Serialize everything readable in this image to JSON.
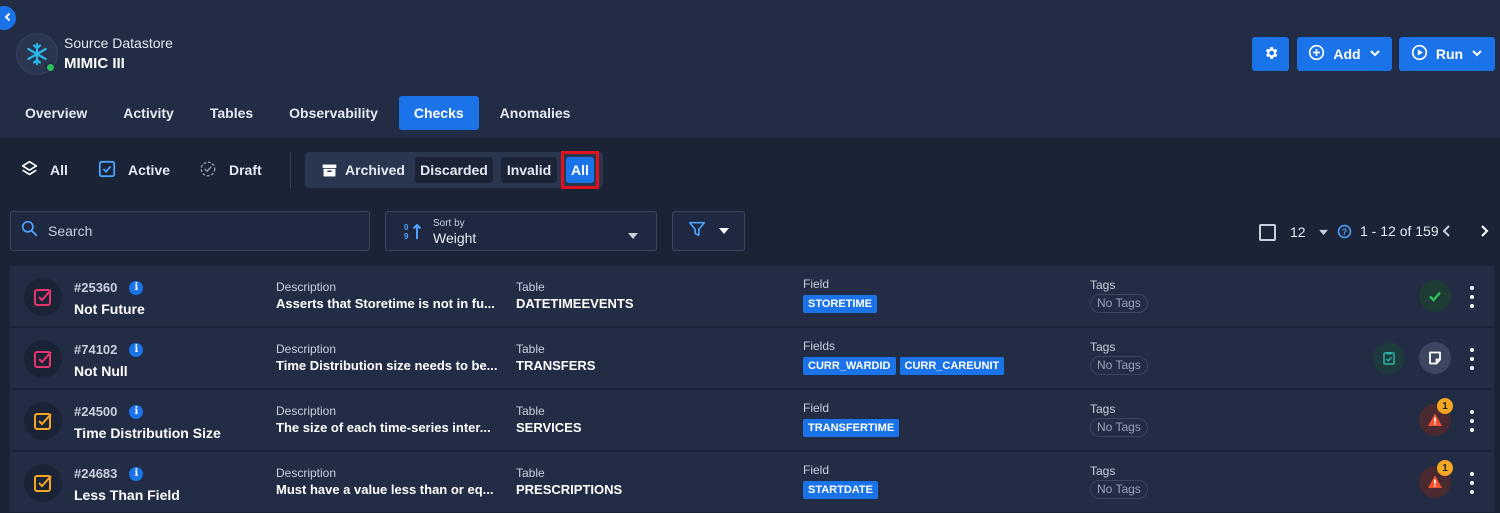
{
  "datastore": {
    "label": "Source Datastore",
    "name": "MIMIC III",
    "status_color": "#2fbf5b"
  },
  "header_buttons": {
    "settings_icon": "gear-icon",
    "add_label": "Add",
    "run_label": "Run"
  },
  "tabs": [
    {
      "label": "Overview"
    },
    {
      "label": "Activity"
    },
    {
      "label": "Tables"
    },
    {
      "label": "Observability"
    },
    {
      "label": "Checks",
      "active": true
    },
    {
      "label": "Anomalies"
    }
  ],
  "filters": {
    "all": "All",
    "active": "Active",
    "draft": "Draft",
    "archived": "Archived",
    "discarded": "Discarded",
    "invalid": "Invalid",
    "archived_all": "All"
  },
  "search": {
    "placeholder": "Search"
  },
  "sort": {
    "label": "Sort by",
    "value": "Weight"
  },
  "pager": {
    "page_size": "12",
    "range": "1 - 12 of 159"
  },
  "rows": [
    {
      "id": "#25360",
      "name": "Not Future",
      "type_color": "#e8336d",
      "description_label": "Description",
      "description": "Asserts that Storetime is not in fu...",
      "table_label": "Table",
      "table": "DATETIMEEVENTS",
      "field_label": "Field",
      "fields": [
        "STORETIME"
      ],
      "tags_label": "Tags",
      "tags": "No Tags",
      "status": "passed"
    },
    {
      "id": "#74102",
      "name": "Not Null",
      "type_color": "#e8336d",
      "description_label": "Description",
      "description": "Time Distribution size needs to be...",
      "table_label": "Table",
      "table": "TRANSFERS",
      "field_label": "Fields",
      "fields": [
        "CURR_WARDID",
        "CURR_CAREUNIT"
      ],
      "tags_label": "Tags",
      "tags": "No Tags",
      "status": "draft"
    },
    {
      "id": "#24500",
      "name": "Time Distribution Size",
      "type_color": "#f5a623",
      "description_label": "Description",
      "description": "The size of each time-series inter...",
      "table_label": "Table",
      "table": "SERVICES",
      "field_label": "Field",
      "fields": [
        "TRANSFERTIME"
      ],
      "tags_label": "Tags",
      "tags": "No Tags",
      "status": "anomaly",
      "anomaly_count": "1"
    },
    {
      "id": "#24683",
      "name": "Less Than Field",
      "type_color": "#f5a623",
      "description_label": "Description",
      "description": "Must have a value less than or eq...",
      "table_label": "Table",
      "table": "PRESCRIPTIONS",
      "field_label": "Field",
      "fields": [
        "STARTDATE"
      ],
      "tags_label": "Tags",
      "tags": "No Tags",
      "status": "anomaly",
      "anomaly_count": "1"
    }
  ]
}
